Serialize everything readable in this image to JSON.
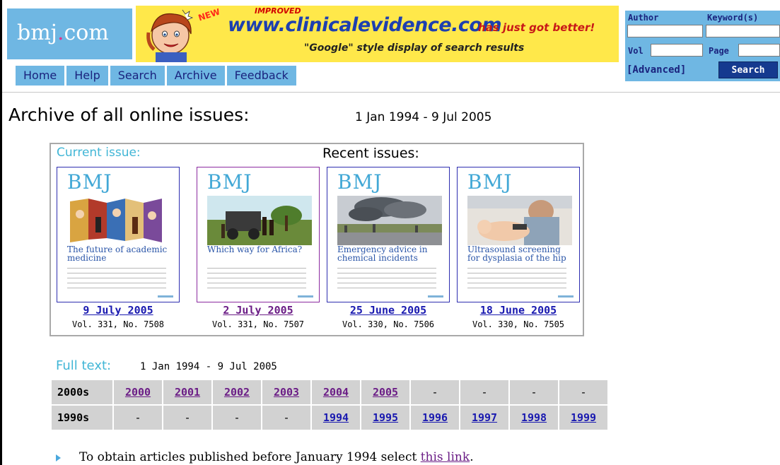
{
  "header": {
    "logo": {
      "prefix": "bmj",
      "dot": ".",
      "suffix": "com"
    },
    "banner": {
      "badge_new": "NEW",
      "badge_improved": "IMPROVED",
      "url": "www.clinicalevidence.com",
      "tagline": "has just got better!",
      "subtitle": "\"Google\" style display of search results"
    },
    "nav": [
      "Home",
      "Help",
      "Search",
      "Archive",
      "Feedback"
    ],
    "search": {
      "author_label": "Author",
      "keywords_label": "Keyword(s)",
      "vol_label": "Vol",
      "page_label": "Page",
      "advanced_label": "[Advanced]",
      "button_label": "Search"
    }
  },
  "main": {
    "title": "Archive of all online issues:",
    "range": "1 Jan 1994 - 9 Jul 2005",
    "current_label": "Current issue:",
    "recent_label": "Recent issues:",
    "issues": [
      {
        "masthead": "BMJ",
        "headline": "The future of academic medicine",
        "date": "9 July 2005",
        "volume": "Vol. 331, No. 7508"
      },
      {
        "masthead": "BMJ",
        "headline": "Which way for Africa?",
        "date": "2 July 2005",
        "volume": "Vol. 331, No. 7507"
      },
      {
        "masthead": "BMJ",
        "headline": "Emergency advice in chemical incidents",
        "date": "25 June 2005",
        "volume": "Vol. 330, No. 7506"
      },
      {
        "masthead": "BMJ",
        "headline": "Ultrasound screening for dysplasia of the hip",
        "date": "18 June 2005",
        "volume": "Vol. 330, No. 7505"
      }
    ],
    "fulltext_label": "Full text:",
    "fulltext_range": "1 Jan 1994 - 9 Jul 2005",
    "years_table": [
      {
        "decade": "2000s",
        "cells": [
          "2000",
          "2001",
          "2002",
          "2003",
          "2004",
          "2005",
          "-",
          "-",
          "-",
          "-"
        ]
      },
      {
        "decade": "1990s",
        "cells": [
          "-",
          "-",
          "-",
          "-",
          "1994",
          "1995",
          "1996",
          "1997",
          "1998",
          "1999"
        ]
      }
    ],
    "note_text": "To obtain articles published before January 1994 select ",
    "note_link": "this link",
    "note_end": "."
  },
  "colors": {
    "brand_blue": "#6fb7e3",
    "banner_yellow": "#ffe84a",
    "link_blue": "#1a1ab0",
    "link_visited": "#6b1d86",
    "accent_cyan": "#41b6d6"
  }
}
